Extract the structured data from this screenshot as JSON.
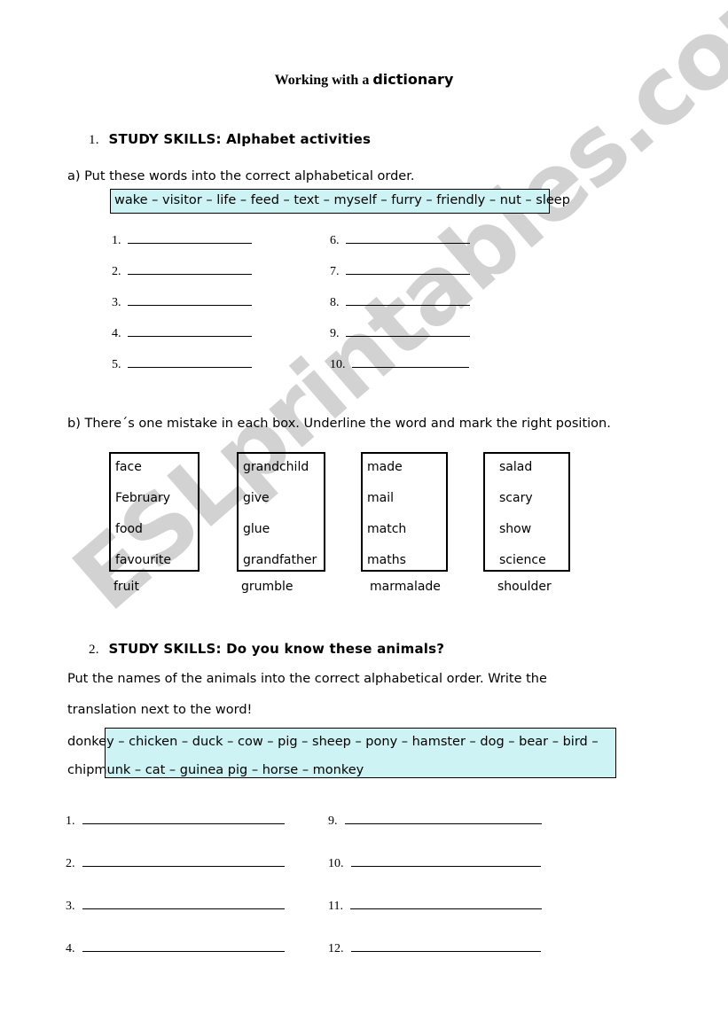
{
  "document": {
    "title_serif": "Working with a ",
    "title_round": "dictionary"
  },
  "section1": {
    "number": "1.",
    "heading": "STUDY SKILLS: Alphabet activities",
    "task_a": {
      "label": "a) Put these words into the correct alphabetical order.",
      "words_line": "wake – visitor – life – feed – text – myself – furry – friendly – nut – sleep",
      "words": [
        "wake",
        "visitor",
        "life",
        "feed",
        "text",
        "myself",
        "furry",
        "friendly",
        "nut",
        "sleep"
      ],
      "answer_numbers_left": [
        "1.",
        "2.",
        "3.",
        "4.",
        "5."
      ],
      "answer_numbers_right": [
        "6.",
        "7.",
        "8.",
        "9.",
        "10."
      ]
    },
    "task_b": {
      "label": "b) There´s one mistake in each box. Underline the word and mark the right position.",
      "boxes": [
        {
          "words": [
            "face",
            "February",
            "food",
            "favourite"
          ],
          "caption": "fruit"
        },
        {
          "words": [
            "grandchild",
            "give",
            "glue",
            "grandfather"
          ],
          "caption": "grumble"
        },
        {
          "words": [
            "made",
            "mail",
            "match",
            "maths"
          ],
          "caption": "marmalade"
        },
        {
          "words": [
            "salad",
            "scary",
            "show",
            "science"
          ],
          "caption": "shoulder"
        }
      ]
    }
  },
  "section2": {
    "number": "2.",
    "heading": "STUDY SKILLS: Do you know these animals?",
    "instruction_line1": "Put the names of the animals into the correct alphabetical order. Write the",
    "instruction_line2": "translation next to the word!",
    "animals_line1": "donkey – chicken – duck – cow – pig – sheep – pony – hamster – dog – bear – bird –",
    "animals_line2": "chipmunk – cat – guinea pig – horse – monkey",
    "animals": [
      "donkey",
      "chicken",
      "duck",
      "cow",
      "pig",
      "sheep",
      "pony",
      "hamster",
      "dog",
      "bear",
      "bird",
      "chipmunk",
      "cat",
      "guinea pig",
      "horse",
      "monkey"
    ],
    "answer_numbers_left": [
      "1.",
      "2.",
      "3.",
      "4."
    ],
    "answer_numbers_right": [
      "9.",
      "10.",
      "11.",
      "12."
    ]
  },
  "watermark": {
    "text": "ESLprintables.com"
  },
  "colors": {
    "highlight": "#cdf3f5",
    "border": "#000000",
    "watermark": "#d2d2d2",
    "page": "#ffffff"
  }
}
